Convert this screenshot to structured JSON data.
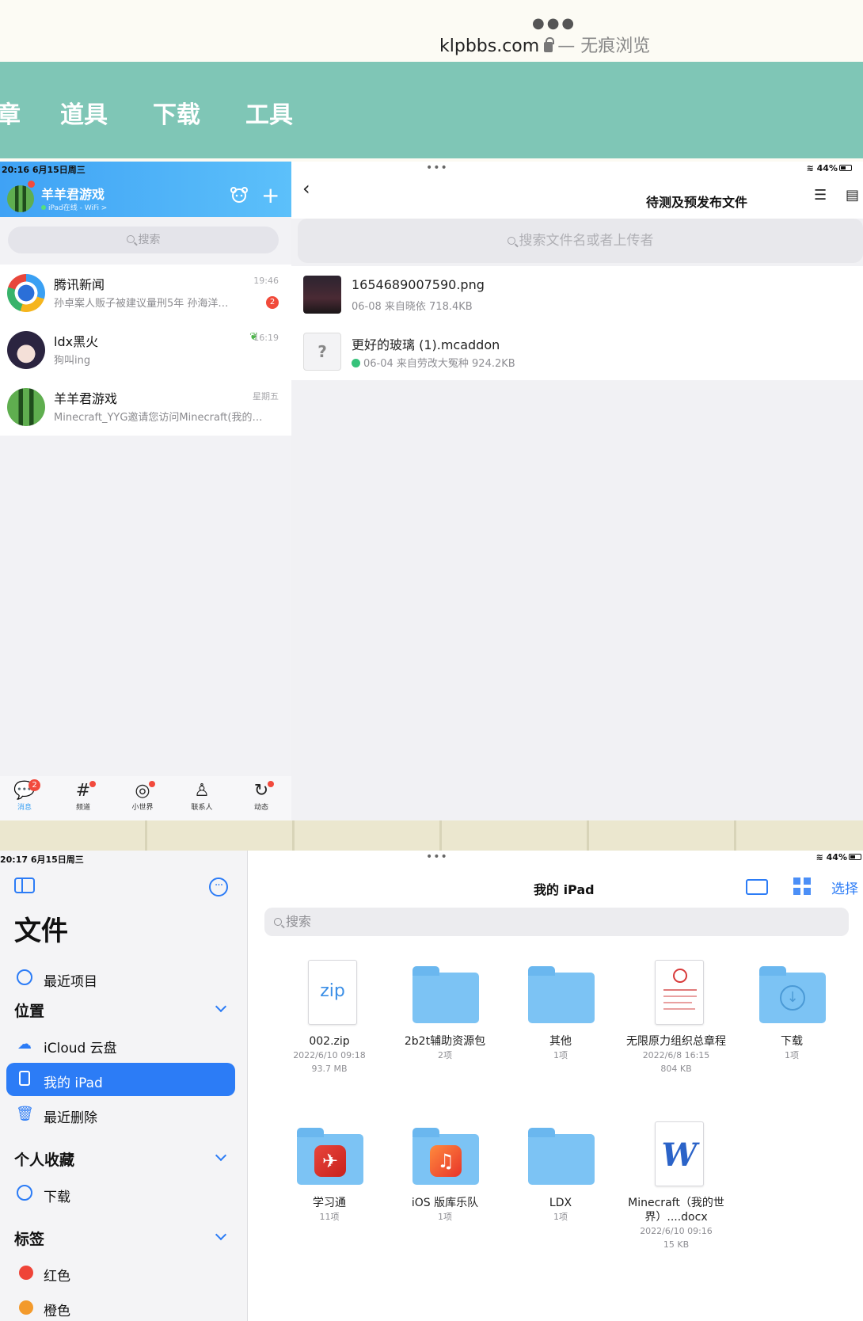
{
  "browser": {
    "domain": "klpbbs.com",
    "mode": "— 无痕浏览"
  },
  "site_nav": [
    "章",
    "道具",
    "下载",
    "工具"
  ],
  "qq": {
    "status_time": "20:16   6月15日周三",
    "username": "羊羊君游戏",
    "online_status": "iPad在线 - WiFi >",
    "search_placeholder": "搜索",
    "chats": [
      {
        "name": "腾讯新闻",
        "message": "孙卓案人贩子被建议量刑5年 孙海洋…",
        "time": "19:46",
        "badge": "2"
      },
      {
        "name": "ldx黑火",
        "message": "狗叫ing",
        "time": "16:19",
        "badge": ""
      },
      {
        "name": "羊羊君游戏",
        "message": "Minecraft_YYG邀请您访问Minecraft(我的…",
        "time": "星期五",
        "badge": ""
      }
    ],
    "tabs": [
      {
        "label": "消息",
        "icon": "💬",
        "count": "2"
      },
      {
        "label": "频道",
        "icon": "#",
        "count": ""
      },
      {
        "label": "小世界",
        "icon": "◎",
        "count": ""
      },
      {
        "label": "联系人",
        "icon": "♙",
        "count": ""
      },
      {
        "label": "动态",
        "icon": "↻",
        "count": ""
      }
    ],
    "right_status": "44%",
    "right_title": "待测及预发布文件",
    "right_search": "搜索文件名或者上传者",
    "files": [
      {
        "name": "1654689007590.png",
        "meta": "06-08 来自晓依 718.4KB"
      },
      {
        "name": "更好的玻璃 (1).mcaddon",
        "meta": "06-04 来自劳改大冤种 924.2KB"
      }
    ]
  },
  "files_app": {
    "status_time": "20:17   6月15日周三",
    "status_battery": "44%",
    "title": "文件",
    "recents": "最近项目",
    "section_locations": "位置",
    "locations": [
      "iCloud 云盘",
      "我的 iPad",
      "最近删除"
    ],
    "section_favorites": "个人收藏",
    "favorites": [
      "下载"
    ],
    "section_tags": "标签",
    "tags": [
      {
        "label": "红色",
        "color": "#ef4438"
      },
      {
        "label": "橙色",
        "color": "#f39a2c"
      }
    ],
    "main_title": "我的 iPad",
    "select_label": "选择",
    "search_placeholder": "搜索",
    "items": [
      {
        "name": "002.zip",
        "sub1": "2022/6/10 09:18",
        "sub2": "93.7 MB"
      },
      {
        "name": "2b2t辅助资源包",
        "sub1": "2项",
        "sub2": ""
      },
      {
        "name": "其他",
        "sub1": "1项",
        "sub2": ""
      },
      {
        "name": "无限原力组织总章程",
        "sub1": "2022/6/8 16:15",
        "sub2": "804 KB"
      },
      {
        "name": "下载",
        "sub1": "1项",
        "sub2": ""
      },
      {
        "name": "学习通",
        "sub1": "11项",
        "sub2": ""
      },
      {
        "name": "iOS 版库乐队",
        "sub1": "1项",
        "sub2": ""
      },
      {
        "name": "LDX",
        "sub1": "1项",
        "sub2": ""
      },
      {
        "name": "Minecraft（我的世界）....docx",
        "sub1": "2022/6/10 09:16",
        "sub2": "15 KB"
      }
    ],
    "zip_label": "zip",
    "word_label": "W"
  }
}
